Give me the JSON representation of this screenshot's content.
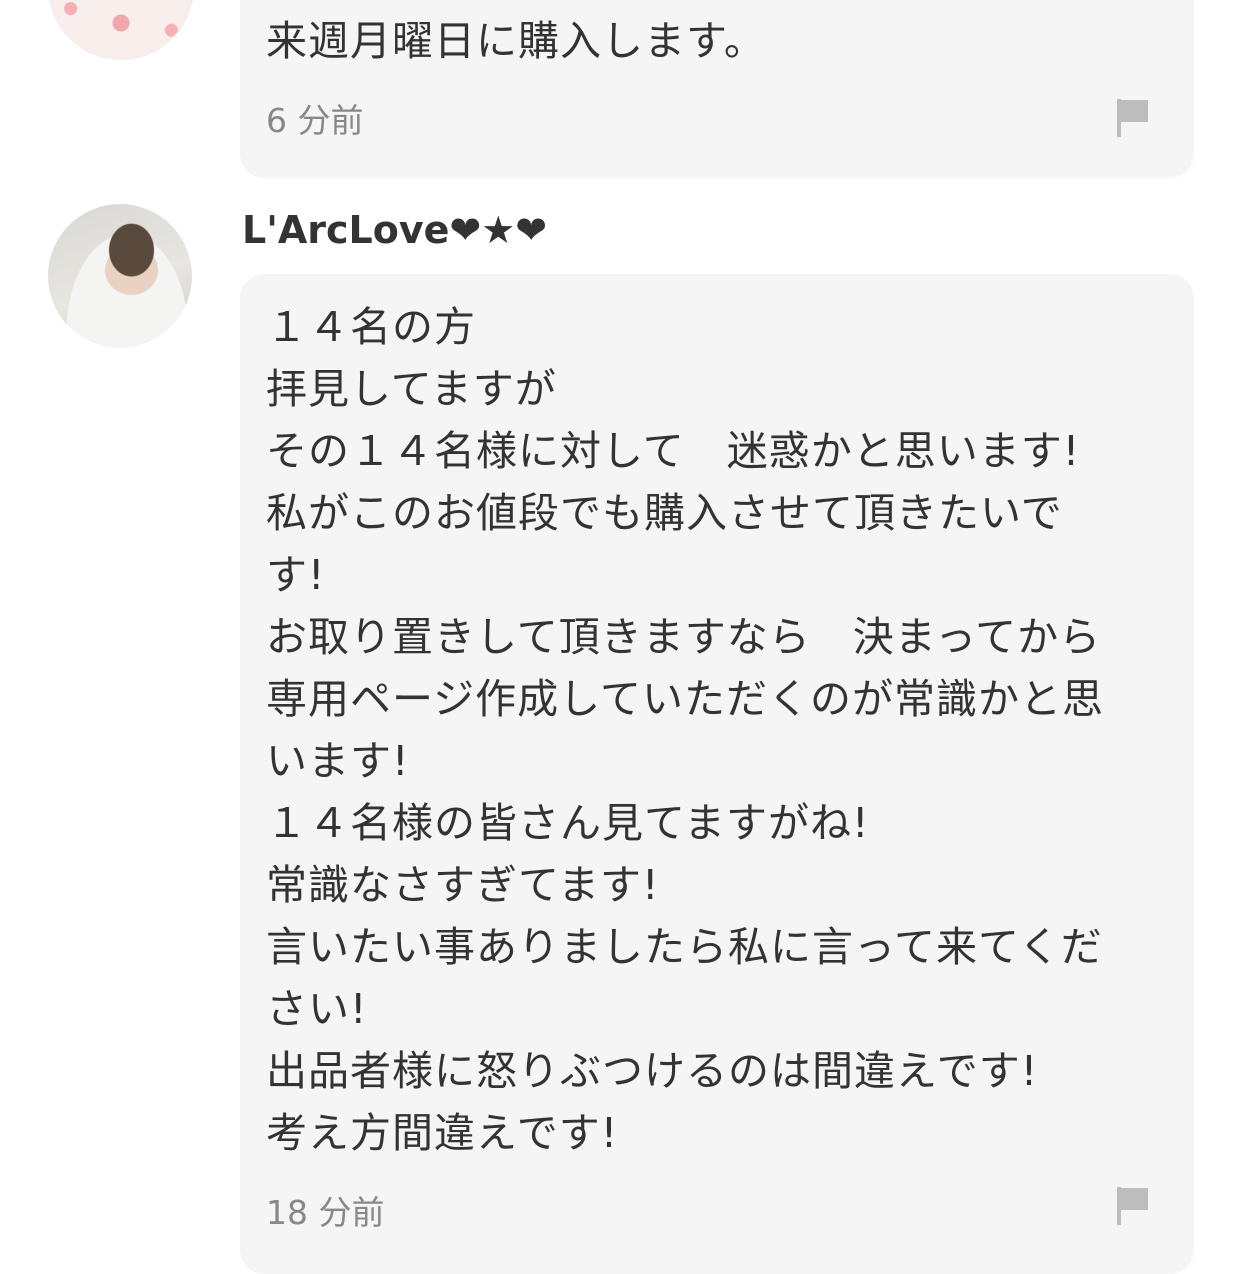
{
  "comments": [
    {
      "username": "",
      "text_lines": [
        "来週月曜日に購入します。"
      ],
      "time": "6 分前",
      "avatar": "flamingo-pattern-avatar",
      "flag_icon": "report-flag-icon"
    },
    {
      "username": "L'ArcLove❤★❤",
      "text_lines": [
        "１４名の方",
        "拝見してますが",
        "その１４名様に対して　迷惑かと思います!",
        "私がこのお値段でも購入させて頂きたいで",
        "す!",
        "お取り置きして頂きますなら　決まってから",
        "専用ページ作成していただくのが常識かと思",
        "います!",
        "１４名様の皆さん見てますがね!",
        "常識なさすぎてます!",
        "言いたい事ありましたら私に言って来てくだ",
        "さい!",
        "出品者様に怒りぶつけるのは間違えです!",
        "考え方間違えです!"
      ],
      "time": "18 分前",
      "avatar": "user-photo-avatar",
      "flag_icon": "report-flag-icon"
    }
  ],
  "colors": {
    "bubble_bg": "#f5f5f5",
    "text": "#333333",
    "meta": "#888888",
    "flag": "#bdbdbd"
  }
}
